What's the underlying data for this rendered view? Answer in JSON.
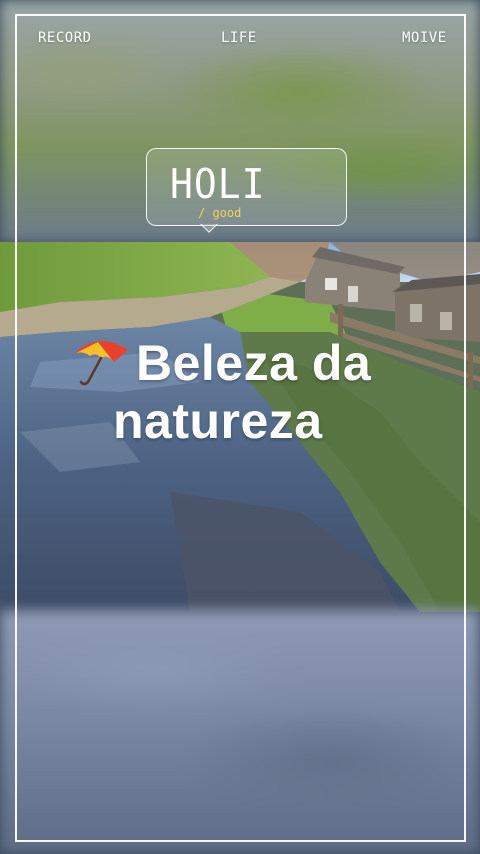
{
  "nav": {
    "left": "RECORD",
    "center": "LIFE",
    "right": "MOIVE"
  },
  "bubble": {
    "title": "HOLI",
    "subtitle": "/ good"
  },
  "caption": {
    "icon": "umbrella-icon",
    "line1": "Beleza da",
    "line2": "natureza"
  },
  "colors": {
    "frame": "#ffffff",
    "subtitle": "#f2d15a",
    "text": "#ffffff"
  }
}
